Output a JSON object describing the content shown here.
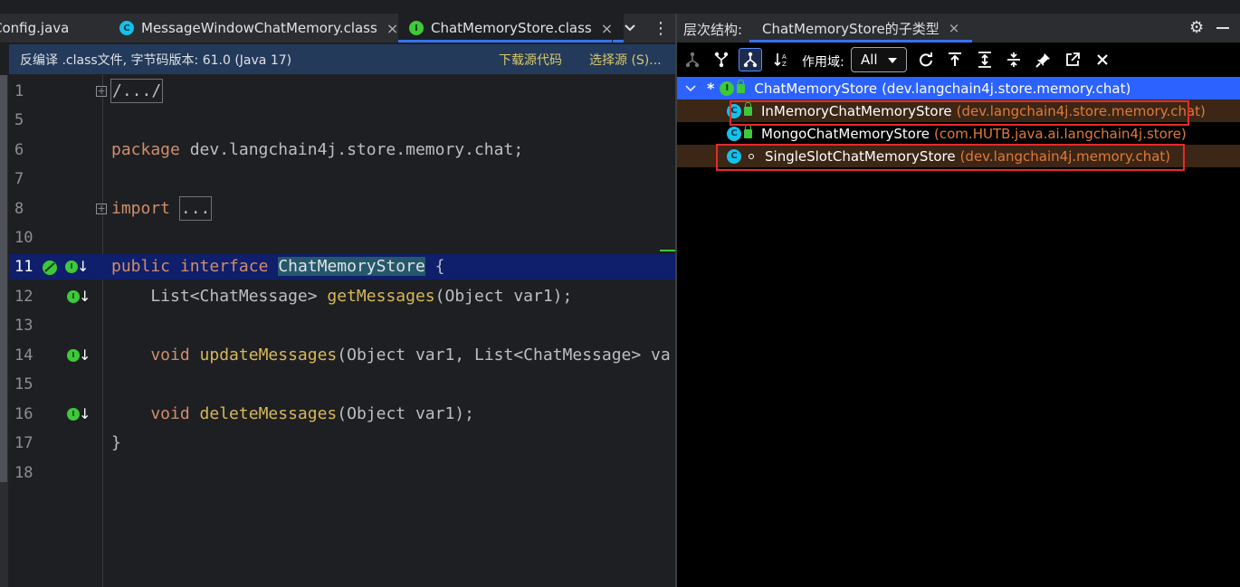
{
  "editor": {
    "tabs": [
      {
        "label": "Config.java",
        "icon": "java-file-icon",
        "active": false
      },
      {
        "label": "MessageWindowChatMemory.class",
        "icon": "class-icon",
        "active": false
      },
      {
        "label": "ChatMemoryStore.class",
        "icon": "interface-icon",
        "active": true
      }
    ],
    "tab_close": "×",
    "more_tabs": "⌄",
    "menu": "⋮",
    "banner": {
      "message": "反编译 .class文件, 字节码版本: 61.0 (Java 17)",
      "download_sources": "下载源代码",
      "choose_sources": "选择源 (S)..."
    },
    "lines": [
      {
        "n": "1",
        "fold": "+",
        "t": "/.../"
      },
      {
        "n": "5",
        "t": ""
      },
      {
        "n": "6",
        "kw": "package",
        "t": " dev.langchain4j.store.memory.chat;"
      },
      {
        "n": "7",
        "t": ""
      },
      {
        "n": "8",
        "fold": "+",
        "kw": "import",
        "t": "..."
      },
      {
        "n": "10",
        "t": ""
      },
      {
        "n": "11",
        "kw1": "public",
        "kw2": "interface",
        "name": "ChatMemoryStore",
        "t": " {"
      },
      {
        "n": "12",
        "pre": "    List<ChatMessage> ",
        "m": "getMessages",
        "t": "(Object var1);"
      },
      {
        "n": "13",
        "t": ""
      },
      {
        "n": "14",
        "kw": "    void",
        "m": "updateMessages",
        "t": "(Object var1, List<ChatMessage> va"
      },
      {
        "n": "15",
        "t": ""
      },
      {
        "n": "16",
        "kw": "    void",
        "m": "deleteMessages",
        "t": "(Object var1);"
      },
      {
        "n": "17",
        "t": "}"
      },
      {
        "n": "18",
        "t": ""
      }
    ],
    "impl_badge": "I"
  },
  "hierarchy": {
    "title": "层次结构:",
    "tab_label": "ChatMemoryStore的子类型",
    "tab_close": "×",
    "toolbar": {
      "scope_label": "作用域:",
      "scope_value": "All"
    },
    "tree": {
      "root": {
        "name": "ChatMemoryStore",
        "pkg": "(dev.langchain4j.store.memory.chat)",
        "badge": "I",
        "marker": "*"
      },
      "children": [
        {
          "name": "InMemoryChatMemoryStore",
          "pkg": "(dev.langchain4j.store.memory.chat)",
          "badge": "C",
          "access": "public",
          "highlighted": true,
          "boxed": true
        },
        {
          "name": "MongoChatMemoryStore",
          "pkg": "(com.HUTB.java.ai.langchain4j.store)",
          "badge": "C",
          "access": "public",
          "highlighted": false,
          "boxed": false
        },
        {
          "name": "SingleSlotChatMemoryStore",
          "pkg": "(dev.langchain4j.memory.chat)",
          "badge": "C",
          "access": "package-private",
          "highlighted": true,
          "boxed": true
        }
      ]
    }
  },
  "colors": {
    "accent": "#3574f0",
    "root_selection": "#2c62ff",
    "highlight_red": "#e52a2a",
    "interface_green": "#3ec93a",
    "class_cyan": "#12c2e9"
  }
}
